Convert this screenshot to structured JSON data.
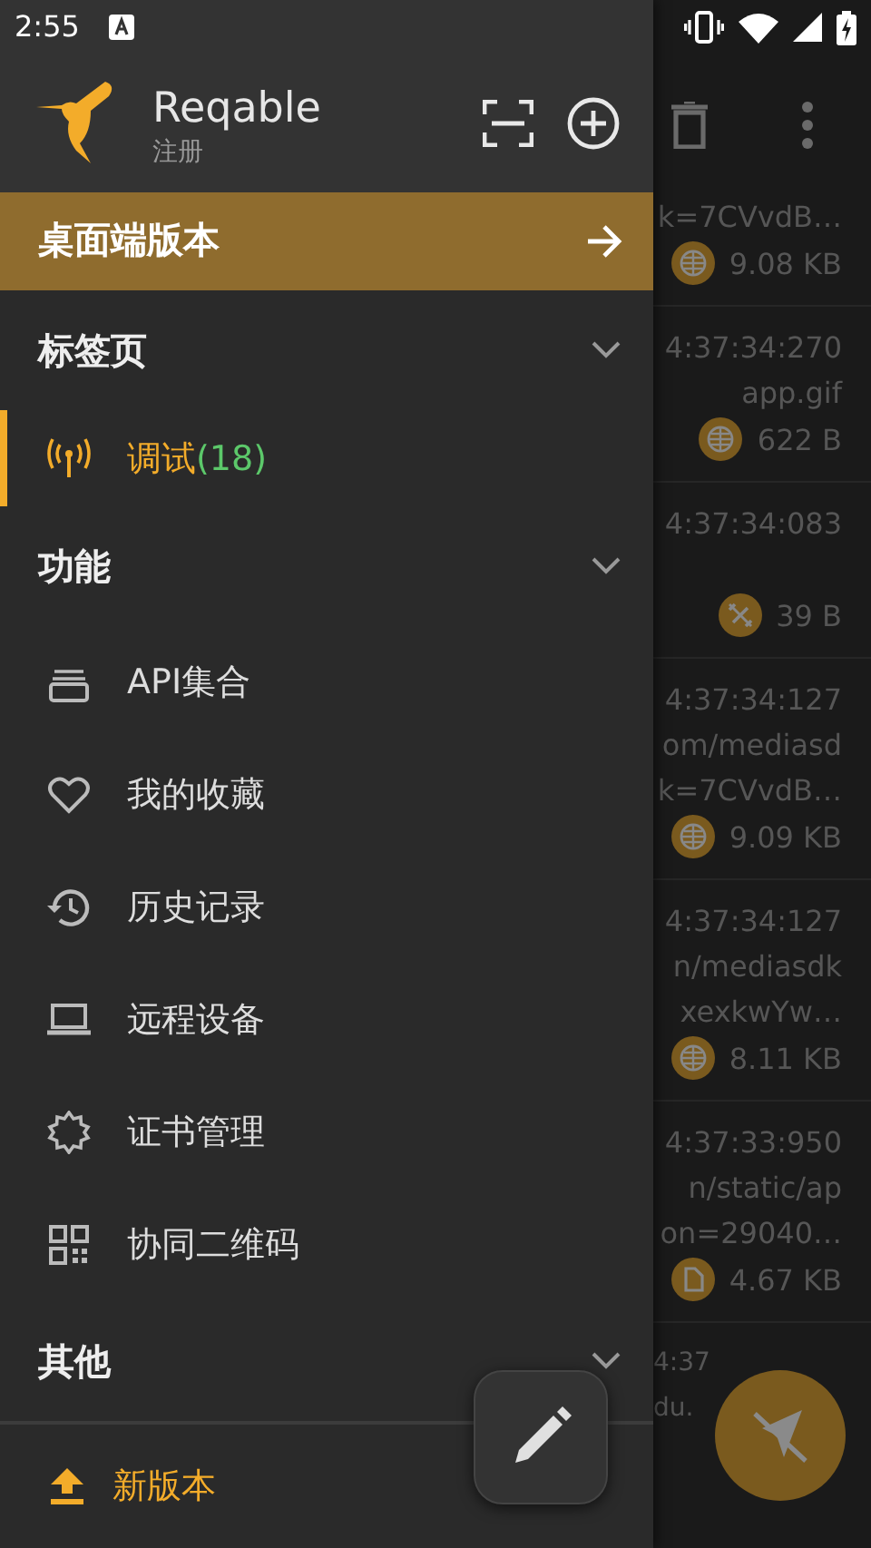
{
  "status_bar": {
    "time": "2:55"
  },
  "drawer": {
    "app_name": "Reqable",
    "account": "注册",
    "banner": "桌面端版本",
    "sections": [
      {
        "title": "标签页",
        "expanded": true,
        "items": [
          {
            "label": "调试",
            "count": "(18)",
            "selected": true
          }
        ]
      },
      {
        "title": "功能",
        "expanded": true,
        "items": [
          {
            "label": "API集合",
            "selected": false
          },
          {
            "label": "我的收藏",
            "selected": false
          },
          {
            "label": "历史记录",
            "selected": false
          },
          {
            "label": "远程设备",
            "selected": false
          },
          {
            "label": "证书管理",
            "selected": false
          },
          {
            "label": "协同二维码",
            "selected": false
          }
        ]
      },
      {
        "title": "其他",
        "expanded": true
      }
    ],
    "update": {
      "label": "新版本"
    }
  },
  "list": {
    "rows": [
      {
        "lines": [
          "k=7CVvdB…"
        ],
        "kind": "web",
        "size": "9.08 KB"
      },
      {
        "time": "4:37:34:270",
        "lines": [
          "app.gif"
        ],
        "kind": "web",
        "size": "622 B"
      },
      {
        "time": "4:37:34:083",
        "kind": "link",
        "size": "39 B"
      },
      {
        "time": "4:37:34:127",
        "lines": [
          "om/mediasd",
          "k=7CVvdB…"
        ],
        "kind": "web",
        "size": "9.09 KB"
      },
      {
        "time": "4:37:34:127",
        "lines": [
          "n/mediasdk",
          "xexkwYw…"
        ],
        "kind": "web",
        "size": "8.11 KB"
      },
      {
        "time": "4:37:33:950",
        "lines": [
          "n/static/ap",
          "on=29040…"
        ],
        "kind": "file",
        "size": "4.67 KB"
      },
      {
        "time": "4:37",
        "lines": [
          "du."
        ]
      }
    ]
  }
}
